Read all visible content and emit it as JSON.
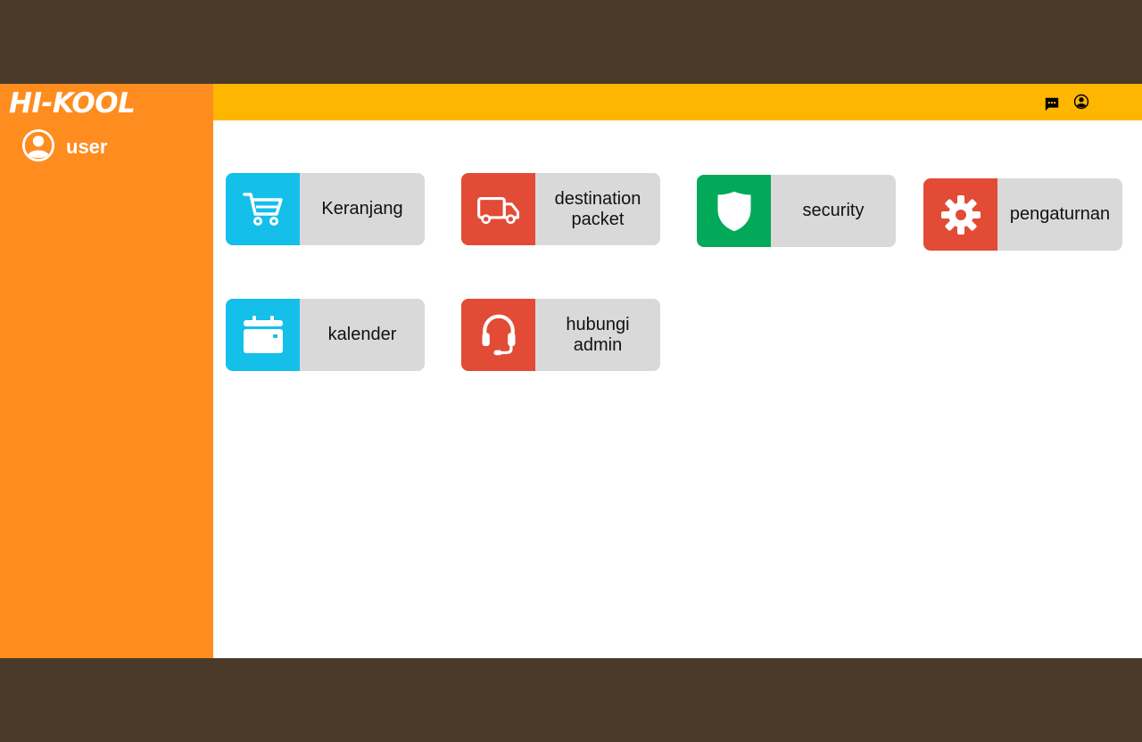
{
  "app": {
    "logo": "HI-KOOL",
    "user_label": "user"
  },
  "topbar": {
    "icons": [
      "chat-icon",
      "account-circle-icon"
    ],
    "color": "#ffb600"
  },
  "tiles": [
    {
      "label": "Keranjang",
      "icon": "cart-icon",
      "color": "#14bfea"
    },
    {
      "label": "destination packet",
      "icon": "truck-icon",
      "color": "#e24b36"
    },
    {
      "label": "security",
      "icon": "shield-icon",
      "color": "#02a959"
    },
    {
      "label": "pengaturnan",
      "icon": "gear-icon",
      "color": "#e24b36"
    },
    {
      "label": "kalender",
      "icon": "calendar-icon",
      "color": "#14bfea"
    },
    {
      "label": "hubungi admin",
      "icon": "headset-icon",
      "color": "#e24b36"
    }
  ],
  "colors": {
    "sidebar": "#ff8c1f",
    "background": "#4a3a2a",
    "tile_bg": "#d9d9d9"
  }
}
